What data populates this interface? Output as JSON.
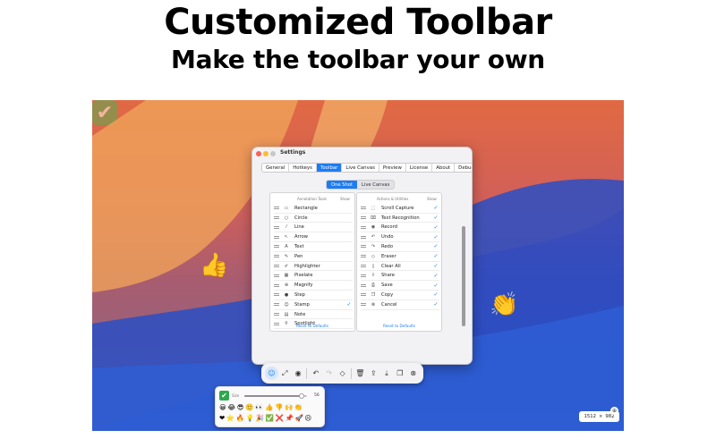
{
  "headline": {
    "title": "Customized Toolbar",
    "subtitle": "Make the toolbar your own"
  },
  "window": {
    "title": "Settings",
    "traffic_colors": [
      "#ff5f57",
      "#febc2e",
      "#c8c8cc"
    ],
    "tabs": [
      "General",
      "Hotkeys",
      "Toolbar",
      "Live Canvas",
      "Preview",
      "License",
      "About",
      "Debug"
    ],
    "active_tab": "Toolbar",
    "segments": [
      "One Shot",
      "Live Canvas"
    ],
    "active_segment": "One Shot",
    "left_panel": {
      "header_name": "Annotation Tools",
      "header_show": "Show",
      "items": [
        {
          "icon": "rectangle-icon",
          "label": "Rectangle",
          "show": false
        },
        {
          "icon": "circle-icon",
          "label": "Circle",
          "show": false
        },
        {
          "icon": "line-icon",
          "label": "Line",
          "show": false
        },
        {
          "icon": "arrow-icon",
          "label": "Arrow",
          "show": false
        },
        {
          "icon": "text-icon",
          "label": "Text",
          "show": false
        },
        {
          "icon": "pen-icon",
          "label": "Pen",
          "show": false
        },
        {
          "icon": "highlighter-icon",
          "label": "Highlighter",
          "show": false
        },
        {
          "icon": "pixelate-icon",
          "label": "Pixelate",
          "show": false
        },
        {
          "icon": "magnify-icon",
          "label": "Magnify",
          "show": false
        },
        {
          "icon": "step-icon",
          "label": "Step",
          "show": false
        },
        {
          "icon": "stamp-icon",
          "label": "Stamp",
          "show": true
        },
        {
          "icon": "note-icon",
          "label": "Note",
          "show": false
        },
        {
          "icon": "spotlight-icon",
          "label": "Spotlight",
          "show": false
        }
      ],
      "reset_label": "Reset to Defaults"
    },
    "right_panel": {
      "header_name": "Actions & Utilities",
      "header_show": "Show",
      "items": [
        {
          "icon": "scroll-capture-icon",
          "label": "Scroll Capture",
          "show": true
        },
        {
          "icon": "text-recognition-icon",
          "label": "Text Recognition",
          "show": true
        },
        {
          "icon": "record-icon",
          "label": "Record",
          "show": true
        },
        {
          "icon": "undo-icon",
          "label": "Undo",
          "show": true
        },
        {
          "icon": "redo-icon",
          "label": "Redo",
          "show": true
        },
        {
          "icon": "eraser-icon",
          "label": "Eraser",
          "show": true
        },
        {
          "icon": "clear-all-icon",
          "label": "Clear All",
          "show": true
        },
        {
          "icon": "share-icon",
          "label": "Share",
          "show": true
        },
        {
          "icon": "save-icon",
          "label": "Save",
          "show": true
        },
        {
          "icon": "copy-icon",
          "label": "Copy",
          "show": true
        },
        {
          "icon": "cancel-icon",
          "label": "Cancel",
          "show": true
        }
      ],
      "reset_label": "Reset to Defaults"
    }
  },
  "floating_emoji": {
    "check": "✔",
    "thumbs_up": "👍",
    "clap": "👏"
  },
  "toolbar": {
    "buttons": [
      {
        "name": "stamp-tool-button",
        "glyph": "☺",
        "state": "active"
      },
      {
        "name": "scroll-capture-button",
        "glyph": "⤢",
        "state": "normal"
      },
      {
        "name": "record-button",
        "glyph": "◉",
        "state": "normal"
      },
      {
        "name": "undo-button",
        "glyph": "↶",
        "state": "normal"
      },
      {
        "name": "redo-button",
        "glyph": "↷",
        "state": "disabled"
      },
      {
        "name": "eraser-button",
        "glyph": "◇",
        "state": "normal"
      },
      {
        "name": "clear-all-button",
        "glyph": "🗑",
        "state": "normal"
      },
      {
        "name": "share-button",
        "glyph": "⇪",
        "state": "normal"
      },
      {
        "name": "save-button",
        "glyph": "⤓",
        "state": "normal"
      },
      {
        "name": "copy-button",
        "glyph": "❐",
        "state": "normal"
      },
      {
        "name": "cancel-button",
        "glyph": "⊗",
        "state": "normal"
      }
    ]
  },
  "emoji_picker": {
    "selected": "✔",
    "size_label": "Size",
    "size_value": "56",
    "size_fraction": 0.92,
    "row1": [
      "😀",
      "😂",
      "😎",
      "🙂",
      "👀",
      "👍",
      "👎",
      "🙌",
      "👏"
    ],
    "row2": [
      "❤",
      "⭐",
      "🔥",
      "💡",
      "🎉",
      "✅",
      "❌",
      "📌",
      "🚀",
      "☹"
    ]
  },
  "dimensions": {
    "width": "1512",
    "sep": "×",
    "height": "982"
  },
  "colors": {
    "accent": "#1e7cf2",
    "check_green": "#2fa84f"
  }
}
